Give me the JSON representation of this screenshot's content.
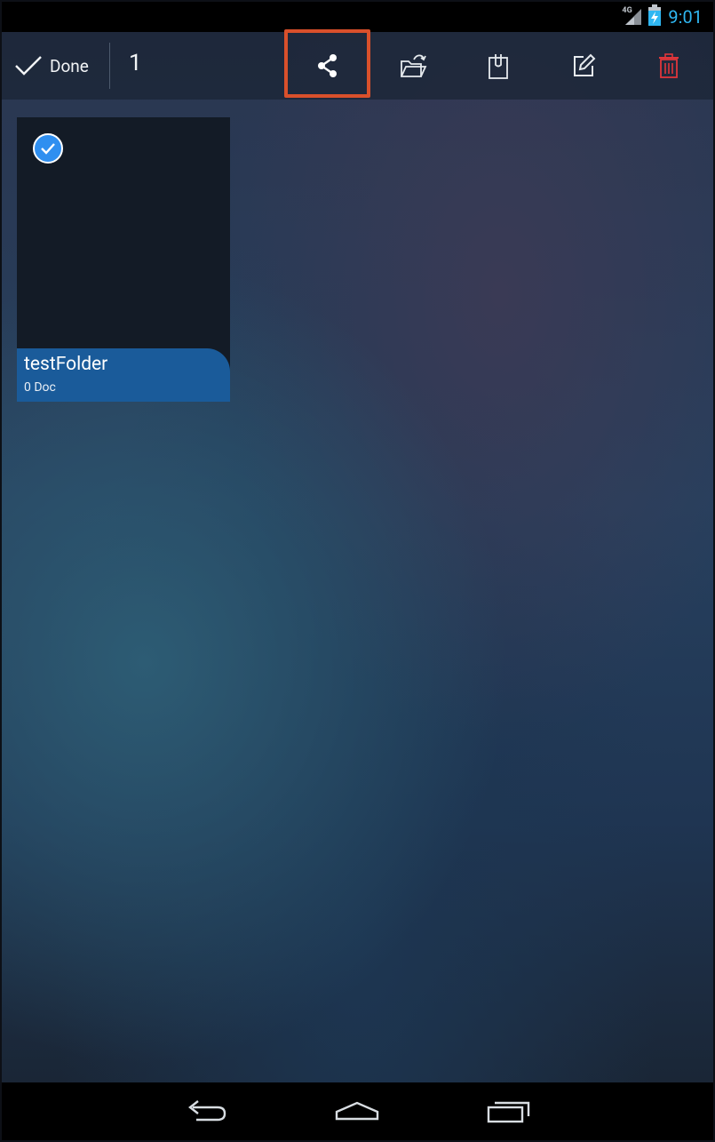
{
  "status_bar": {
    "network": "4G",
    "time": "9:01"
  },
  "action_bar": {
    "done_label": "Done",
    "selected_count": "1",
    "actions": [
      "share-icon",
      "move-folder-icon",
      "clipboard-icon",
      "edit-icon",
      "trash-icon"
    ]
  },
  "folders": [
    {
      "name": "testFolder",
      "doc_count": "0 Doc",
      "selected": true
    }
  ],
  "colors": {
    "accent": "#2fb7f2",
    "tile_label_bg": "#1a5b9a",
    "delete": "#e0363b",
    "highlight": "#d9502b"
  }
}
